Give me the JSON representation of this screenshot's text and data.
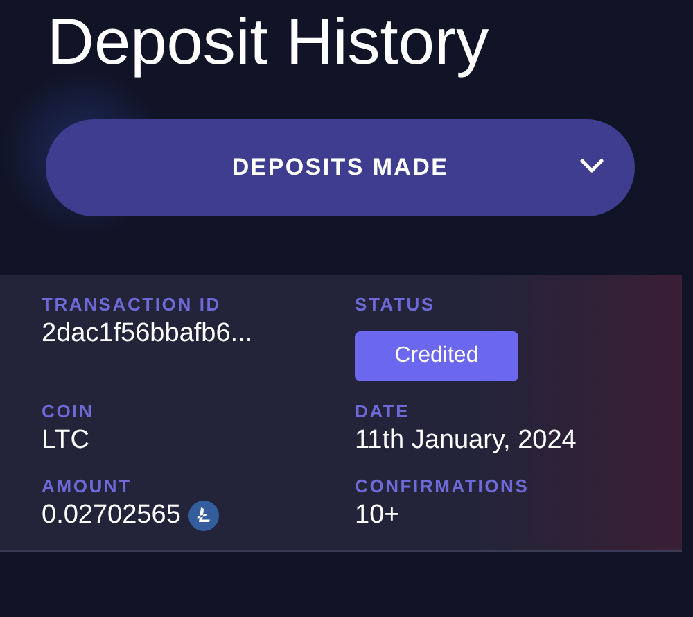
{
  "title": "Deposit History",
  "filter": {
    "label": "DEPOSITS MADE",
    "expanded": false
  },
  "deposit": {
    "fields": [
      {
        "label": "TRANSACTION ID",
        "value": "2dac1f56bbafb6...",
        "kind": "text"
      },
      {
        "label": "STATUS",
        "value": "Credited",
        "kind": "badge"
      },
      {
        "label": "COIN",
        "value": "LTC",
        "kind": "text"
      },
      {
        "label": "DATE",
        "value": "11th January, 2024",
        "kind": "text"
      },
      {
        "label": "AMOUNT",
        "value": "0.02702565",
        "kind": "amount"
      },
      {
        "label": "CONFIRMATIONS",
        "value": "10+",
        "kind": "text"
      }
    ]
  }
}
